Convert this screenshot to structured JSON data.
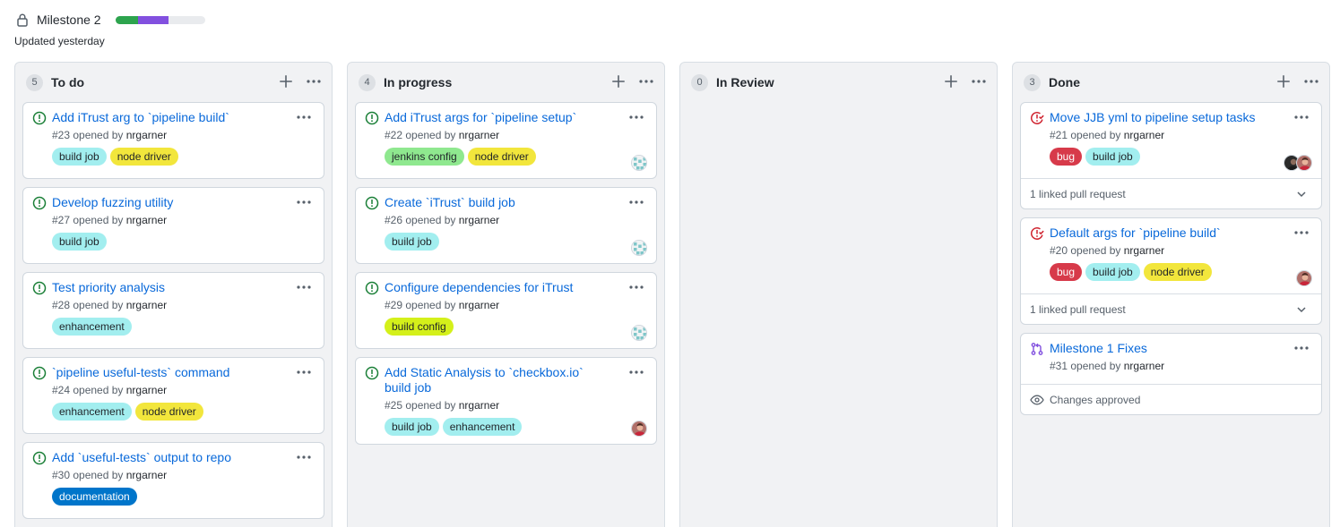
{
  "milestone": {
    "title": "Milestone 2",
    "updated": "Updated yesterday",
    "progress": {
      "done_fraction": 0.25,
      "in_progress_fraction": 0.34
    },
    "colors": {
      "done": "#2da44e",
      "in_progress": "#8250df",
      "track": "#e9ebee"
    }
  },
  "columns": [
    {
      "count": "5",
      "title": "To do",
      "cards": [
        {
          "state": "open-issue",
          "title": "Add iTrust arg to `pipeline build`",
          "meta_prefix": "#23 opened by",
          "author": "nrgarner",
          "labels": [
            {
              "name": "build job",
              "color": "#a2eeef"
            },
            {
              "name": "node driver",
              "color": "#f2e63c"
            }
          ],
          "assignees": [],
          "footer": null
        },
        {
          "state": "open-issue",
          "title": "Develop fuzzing utility",
          "meta_prefix": "#27 opened by",
          "author": "nrgarner",
          "labels": [
            {
              "name": "build job",
              "color": "#a2eeef"
            }
          ],
          "assignees": [],
          "footer": null
        },
        {
          "state": "open-issue",
          "title": "Test priority analysis",
          "meta_prefix": "#28 opened by",
          "author": "nrgarner",
          "labels": [
            {
              "name": "enhancement",
              "color": "#a2eeef"
            }
          ],
          "assignees": [],
          "footer": null
        },
        {
          "state": "open-issue",
          "title": "`pipeline useful-tests` command",
          "meta_prefix": "#24 opened by",
          "author": "nrgarner",
          "labels": [
            {
              "name": "enhancement",
              "color": "#a2eeef"
            },
            {
              "name": "node driver",
              "color": "#f2e63c"
            }
          ],
          "assignees": [],
          "footer": null
        },
        {
          "state": "open-issue",
          "title": "Add `useful-tests` output to repo",
          "meta_prefix": "#30 opened by",
          "author": "nrgarner",
          "labels": [
            {
              "name": "documentation",
              "color": "#0075ca",
              "text": "#ffffff"
            }
          ],
          "assignees": [],
          "footer": null
        }
      ]
    },
    {
      "count": "4",
      "title": "In progress",
      "cards": [
        {
          "state": "open-issue",
          "title": "Add iTrust args for `pipeline setup`",
          "meta_prefix": "#22 opened by",
          "author": "nrgarner",
          "labels": [
            {
              "name": "jenkins config",
              "color": "#8fe88f"
            },
            {
              "name": "node driver",
              "color": "#f2e63c"
            }
          ],
          "assignees": [
            "identicon"
          ],
          "footer": null
        },
        {
          "state": "open-issue",
          "title": "Create `iTrust` build job",
          "meta_prefix": "#26 opened by",
          "author": "nrgarner",
          "labels": [
            {
              "name": "build job",
              "color": "#a2eeef"
            }
          ],
          "assignees": [
            "identicon"
          ],
          "footer": null
        },
        {
          "state": "open-issue",
          "title": "Configure dependencies for iTrust",
          "meta_prefix": "#29 opened by",
          "author": "nrgarner",
          "labels": [
            {
              "name": "build config",
              "color": "#d4f01a"
            }
          ],
          "assignees": [
            "identicon"
          ],
          "footer": null
        },
        {
          "state": "open-issue",
          "title": "Add Static Analysis to `checkbox.io` build job",
          "meta_prefix": "#25 opened by",
          "author": "nrgarner",
          "labels": [
            {
              "name": "build job",
              "color": "#a2eeef"
            },
            {
              "name": "enhancement",
              "color": "#a2eeef"
            }
          ],
          "assignees": [
            "photo"
          ],
          "footer": null
        }
      ]
    },
    {
      "count": "0",
      "title": "In Review",
      "cards": []
    },
    {
      "count": "3",
      "title": "Done",
      "cards": [
        {
          "state": "closed-issue",
          "title": "Move JJB yml to pipeline setup tasks",
          "meta_prefix": "#21 opened by",
          "author": "nrgarner",
          "labels": [
            {
              "name": "bug",
              "color": "#d73a4a",
              "text": "#ffffff"
            },
            {
              "name": "build job",
              "color": "#a2eeef"
            }
          ],
          "assignees": [
            "photo-dark",
            "photo"
          ],
          "footer": {
            "kind": "linked",
            "text": "1 linked pull request"
          }
        },
        {
          "state": "closed-issue",
          "title": "Default args for `pipeline build`",
          "meta_prefix": "#20 opened by",
          "author": "nrgarner",
          "labels": [
            {
              "name": "bug",
              "color": "#d73a4a",
              "text": "#ffffff"
            },
            {
              "name": "build job",
              "color": "#a2eeef"
            },
            {
              "name": "node driver",
              "color": "#f2e63c"
            }
          ],
          "assignees": [
            "photo"
          ],
          "footer": {
            "kind": "linked",
            "text": "1 linked pull request"
          }
        },
        {
          "state": "pull-request",
          "title": "Milestone 1 Fixes",
          "meta_prefix": "#31 opened by",
          "author": "nrgarner",
          "labels": [],
          "assignees": [],
          "footer": {
            "kind": "review",
            "text": "Changes approved"
          }
        }
      ]
    }
  ]
}
